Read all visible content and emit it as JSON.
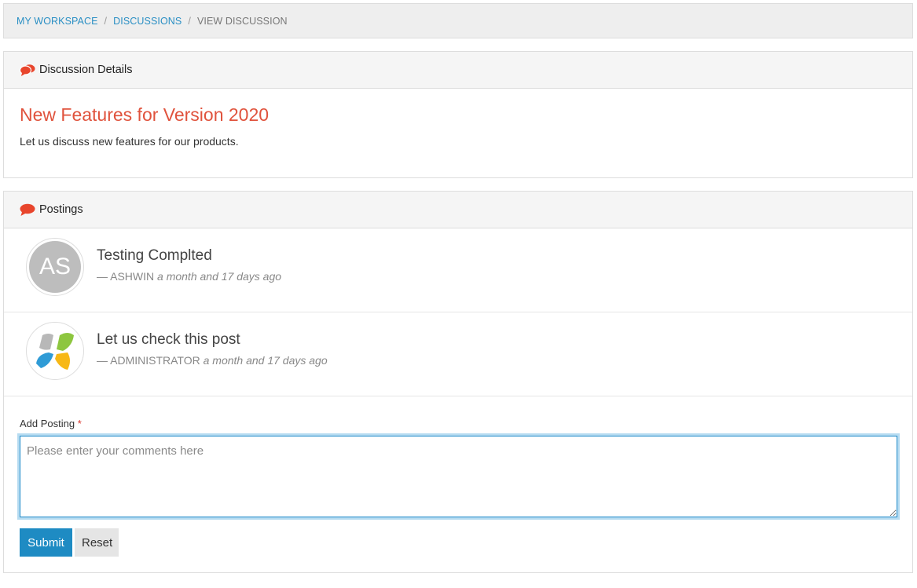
{
  "breadcrumb": {
    "items": [
      "MY WORKSPACE",
      "DISCUSSIONS"
    ],
    "current": "VIEW DISCUSSION",
    "separator": "/"
  },
  "details": {
    "heading": "Discussion Details",
    "title": "New Features for Version 2020",
    "description": "Let us discuss new features for our products."
  },
  "postings": {
    "heading": "Postings",
    "items": [
      {
        "initials": "AS",
        "title": "Testing Complted",
        "author": "— ASHWIN",
        "when": "a month and 17 days ago"
      },
      {
        "initials": "",
        "title": "Let us check this post",
        "author": "— ADMINISTRATOR",
        "when": "a month and 17 days ago"
      }
    ]
  },
  "form": {
    "label": "Add Posting",
    "required_mark": "*",
    "placeholder": "Please enter your comments here",
    "submit_label": "Submit",
    "reset_label": "Reset"
  },
  "colors": {
    "accent_red": "#e0533d",
    "link_blue": "#2a8fc4",
    "button_blue": "#1e8bc3"
  },
  "icons": {
    "details": "comments-icon",
    "postings": "comment-icon"
  }
}
